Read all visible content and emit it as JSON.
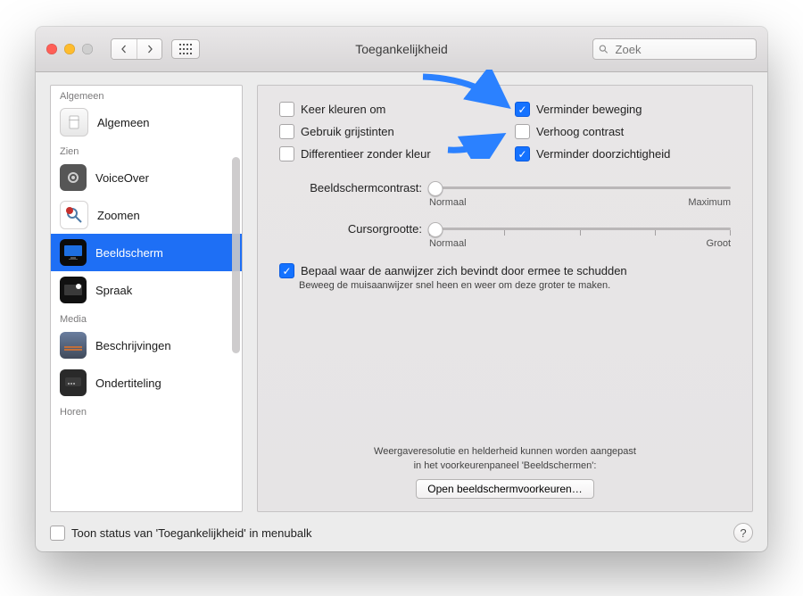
{
  "window": {
    "title": "Toegankelijkheid",
    "search_placeholder": "Zoek"
  },
  "sidebar": {
    "sections": [
      {
        "name": "Algemeen",
        "items": [
          {
            "label": "Algemeen"
          }
        ]
      },
      {
        "name": "Zien",
        "items": [
          {
            "label": "VoiceOver"
          },
          {
            "label": "Zoomen"
          },
          {
            "label": "Beeldscherm",
            "selected": true
          },
          {
            "label": "Spraak"
          }
        ]
      },
      {
        "name": "Media",
        "items": [
          {
            "label": "Beschrijvingen"
          },
          {
            "label": "Ondertiteling"
          }
        ]
      },
      {
        "name": "Horen",
        "items": []
      }
    ]
  },
  "panel": {
    "checkboxes_left": [
      {
        "label": "Keer kleuren om",
        "checked": false
      },
      {
        "label": "Gebruik grijstinten",
        "checked": false
      },
      {
        "label": "Differentieer zonder kleur",
        "checked": false
      }
    ],
    "checkboxes_right": [
      {
        "label": "Verminder beweging",
        "checked": true
      },
      {
        "label": "Verhoog contrast",
        "checked": false
      },
      {
        "label": "Verminder doorzichtigheid",
        "checked": true
      }
    ],
    "slider_contrast": {
      "label": "Beeldschermcontrast:",
      "min_label": "Normaal",
      "max_label": "Maximum",
      "value": 0,
      "min": 0,
      "max": 100
    },
    "slider_cursor": {
      "label": "Cursorgrootte:",
      "min_label": "Normaal",
      "max_label": "Groot",
      "value": 0,
      "min": 0,
      "max": 100
    },
    "shake_pointer": {
      "checked": true,
      "label": "Bepaal waar de aanwijzer zich bevindt door ermee te schudden",
      "subtext": "Beweeg de muisaanwijzer snel heen en weer om deze groter te maken."
    },
    "hint_line1": "Weergaveresolutie en helderheid kunnen worden aangepast",
    "hint_line2": "in het voorkeurenpaneel 'Beeldschermen':",
    "open_display_prefs": "Open beeldschermvoorkeuren…"
  },
  "footer": {
    "show_menu_status": "Toon status van 'Toegankelijkheid' in menubalk",
    "show_menu_status_checked": false
  }
}
